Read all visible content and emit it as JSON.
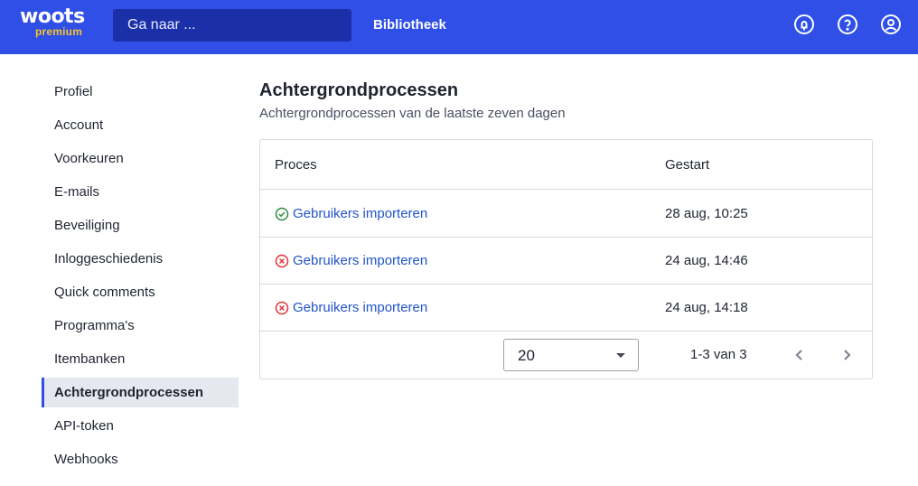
{
  "header": {
    "logo_text": "woots",
    "logo_sub": "premium",
    "search_placeholder": "Ga naar ...",
    "nav_library": "Bibliotheek",
    "icons": [
      "bell-icon",
      "help-icon",
      "account-icon"
    ],
    "colors": {
      "bar": "#2f4fe6",
      "search": "#1b2fa8",
      "logo_sub": "#f6c22d"
    }
  },
  "sidebar": {
    "items": [
      {
        "label": "Profiel"
      },
      {
        "label": "Account"
      },
      {
        "label": "Voorkeuren"
      },
      {
        "label": "E-mails"
      },
      {
        "label": "Beveiliging"
      },
      {
        "label": "Inloggeschiedenis"
      },
      {
        "label": "Quick comments"
      },
      {
        "label": "Programma's"
      },
      {
        "label": "Itembanken"
      },
      {
        "label": "Achtergrondprocessen",
        "active": true
      },
      {
        "label": "API-token"
      },
      {
        "label": "Webhooks"
      }
    ]
  },
  "main": {
    "title": "Achtergrondprocessen",
    "subtitle": "Achtergrondprocessen van de laatste zeven dagen",
    "table": {
      "columns": [
        "Proces",
        "Gestart"
      ],
      "rows": [
        {
          "status": "success",
          "status_icon": "check-circle-icon",
          "process": "Gebruikers importeren",
          "started": "28 aug, 10:25"
        },
        {
          "status": "failed",
          "status_icon": "x-circle-icon",
          "process": "Gebruikers importeren",
          "started": "24 aug, 14:46"
        },
        {
          "status": "failed",
          "status_icon": "x-circle-icon",
          "process": "Gebruikers importeren",
          "started": "24 aug, 14:18"
        }
      ]
    },
    "pagination": {
      "page_size": "20",
      "range": "1-3 van 3"
    },
    "colors": {
      "success": "#2e8b3e",
      "failed": "#e0323a",
      "link": "#2153c9",
      "active_marker": "#2f4fe6"
    }
  }
}
